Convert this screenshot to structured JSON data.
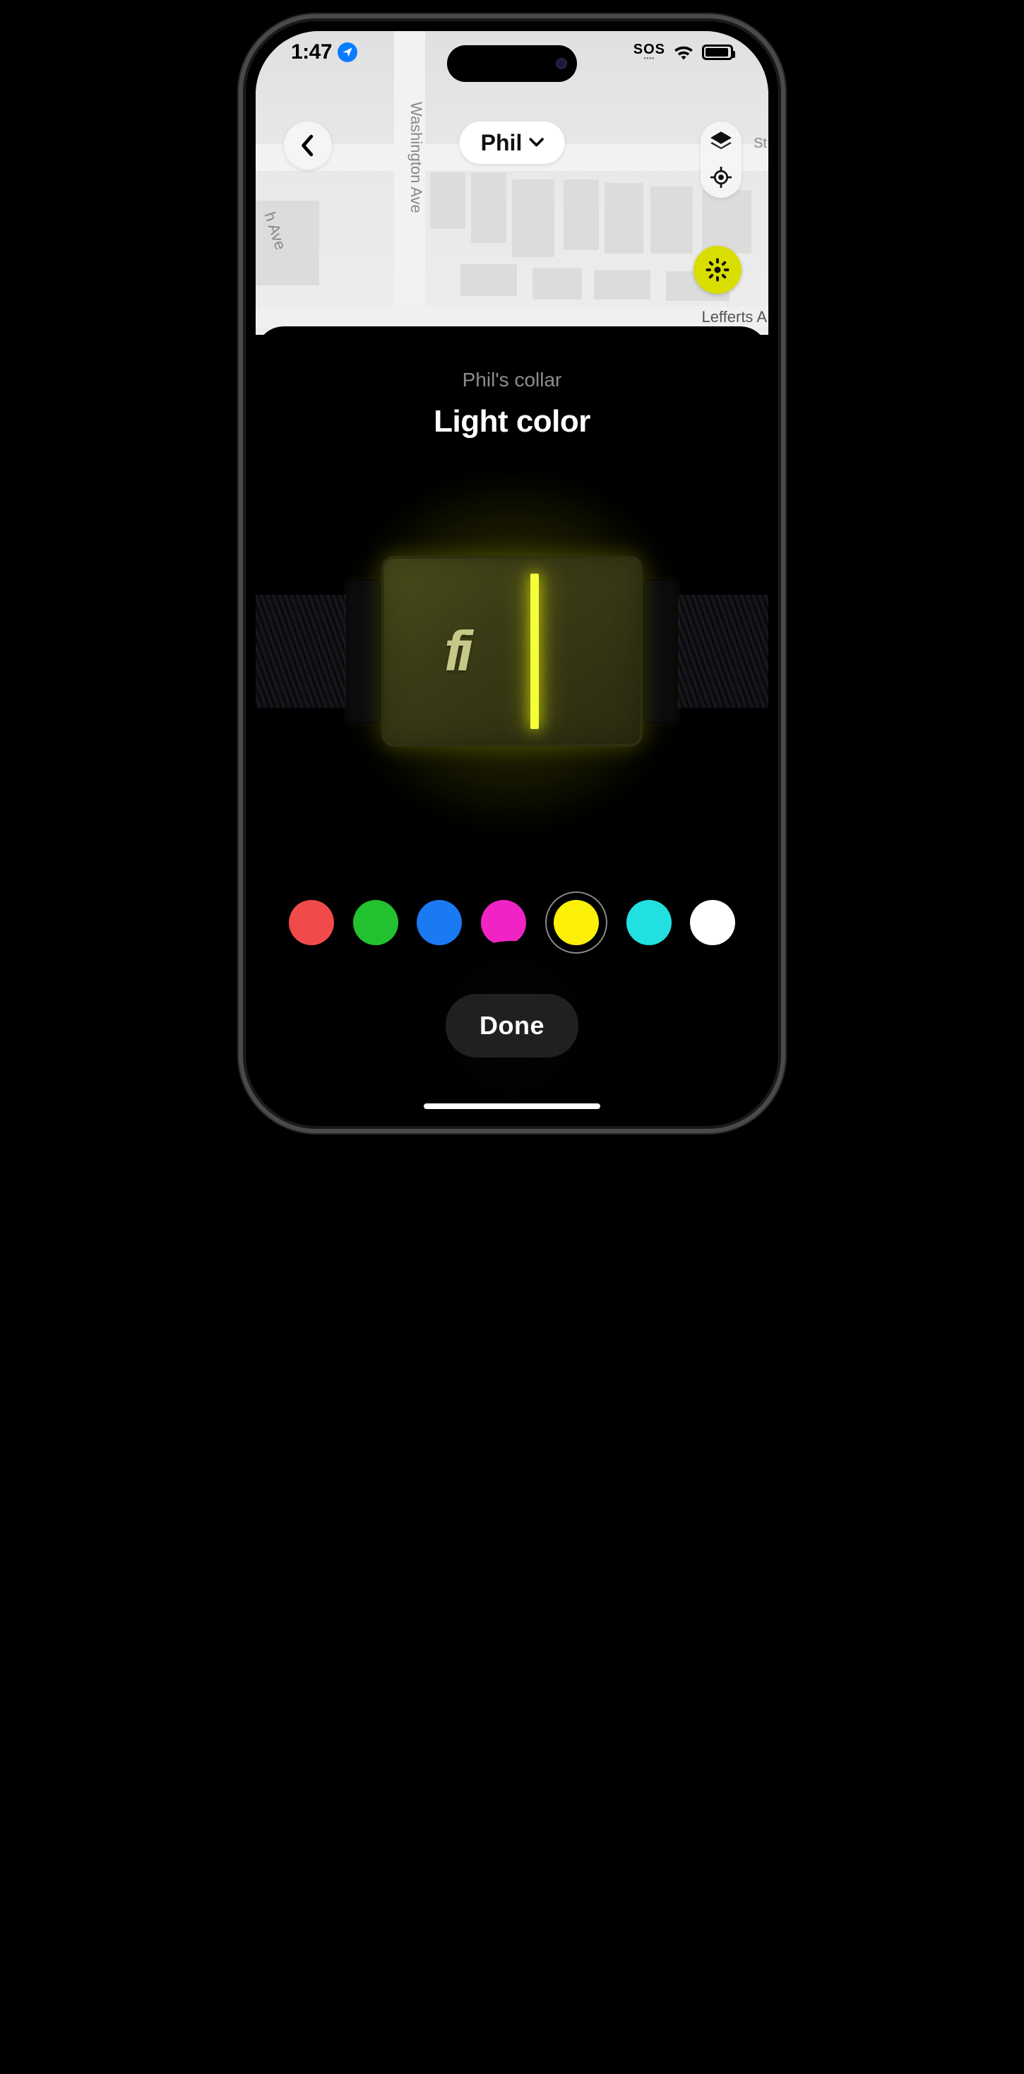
{
  "status": {
    "time": "1:47",
    "sos": "SOS",
    "battery_level": 0.95
  },
  "map": {
    "street_vertical": "Washington Ave",
    "street_left": "h Ave",
    "street_right_top": "St",
    "street_right_bottom": "Lefferts A"
  },
  "header": {
    "pet_name": "Phil"
  },
  "sheet": {
    "subtitle": "Phil's collar",
    "title": "Light color",
    "logo_text": "fi",
    "done_label": "Done"
  },
  "colors": {
    "options": [
      {
        "name": "red",
        "hex": "#f04a4a"
      },
      {
        "name": "green",
        "hex": "#22c130"
      },
      {
        "name": "blue",
        "hex": "#1a7af2"
      },
      {
        "name": "magenta",
        "hex": "#f024c4"
      },
      {
        "name": "yellow",
        "hex": "#fcef08"
      },
      {
        "name": "cyan",
        "hex": "#22e0e0"
      },
      {
        "name": "white",
        "hex": "#ffffff"
      }
    ],
    "selected_index": 4,
    "selected_hex": "#d8de00"
  }
}
